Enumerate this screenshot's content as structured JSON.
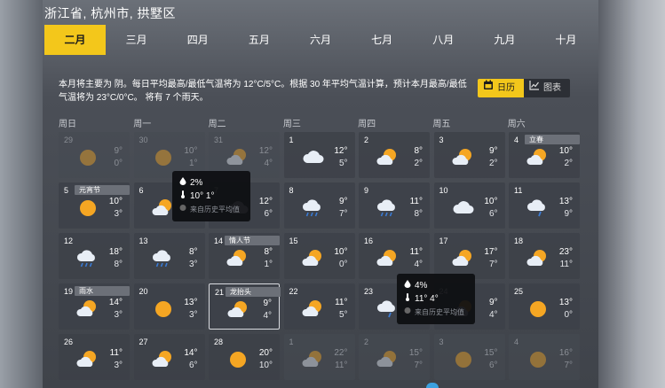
{
  "location": "浙江省, 杭州市, 拱墅区",
  "months": [
    {
      "label": "二月",
      "active": true
    },
    {
      "label": "三月",
      "active": false
    },
    {
      "label": "四月",
      "active": false
    },
    {
      "label": "五月",
      "active": false
    },
    {
      "label": "六月",
      "active": false
    },
    {
      "label": "七月",
      "active": false
    },
    {
      "label": "八月",
      "active": false
    },
    {
      "label": "九月",
      "active": false
    },
    {
      "label": "十月",
      "active": false
    }
  ],
  "summary": "本月将主要为 阴。每日平均最高/最低气温将为 12°C/5°C。根据 30 年平均气温计算，预计本月最高/最低气温将为 23°C/0°C。 将有 7 个雨天。",
  "view_toggle": {
    "calendar_label": "日历",
    "chart_label": "图表"
  },
  "weekdays": [
    "周日",
    "周一",
    "周二",
    "周三",
    "周四",
    "周五",
    "周六"
  ],
  "colors": {
    "accent": "#f3c71b"
  },
  "days": [
    {
      "date": "29",
      "hi": "9°",
      "lo": "0°",
      "icon": "sun-icon",
      "dim": true
    },
    {
      "date": "30",
      "hi": "10°",
      "lo": "1°",
      "icon": "sun-icon",
      "dim": true
    },
    {
      "date": "31",
      "hi": "12°",
      "lo": "4°",
      "icon": "partly-cloudy-icon",
      "dim": true
    },
    {
      "date": "1",
      "hi": "12°",
      "lo": "5°",
      "icon": "cloud-icon"
    },
    {
      "date": "2",
      "hi": "8°",
      "lo": "2°",
      "icon": "partly-cloudy-icon"
    },
    {
      "date": "3",
      "hi": "9°",
      "lo": "2°",
      "icon": "partly-cloudy-icon"
    },
    {
      "date": "4",
      "hi": "10°",
      "lo": "2°",
      "icon": "partly-cloudy-icon",
      "badge": "立春"
    },
    {
      "date": "5",
      "hi": "10°",
      "lo": "3°",
      "icon": "sun-icon",
      "badge": "元宵节"
    },
    {
      "date": "6",
      "hi": "",
      "lo": "",
      "icon": "partly-cloudy-icon"
    },
    {
      "date": "7",
      "hi": "12°",
      "lo": "6°",
      "icon": "cloud-icon"
    },
    {
      "date": "8",
      "hi": "9°",
      "lo": "7°",
      "icon": "rain-icon"
    },
    {
      "date": "9",
      "hi": "11°",
      "lo": "8°",
      "icon": "rain-icon"
    },
    {
      "date": "10",
      "hi": "10°",
      "lo": "6°",
      "icon": "cloud-icon"
    },
    {
      "date": "11",
      "hi": "13°",
      "lo": "9°",
      "icon": "cloud-rain-icon"
    },
    {
      "date": "12",
      "hi": "18°",
      "lo": "8°",
      "icon": "rain-icon"
    },
    {
      "date": "13",
      "hi": "8°",
      "lo": "3°",
      "icon": "rain-icon"
    },
    {
      "date": "14",
      "hi": "8°",
      "lo": "1°",
      "icon": "partly-cloudy-icon",
      "badge": "情人节"
    },
    {
      "date": "15",
      "hi": "10°",
      "lo": "0°",
      "icon": "partly-cloudy-icon"
    },
    {
      "date": "16",
      "hi": "11°",
      "lo": "4°",
      "icon": "partly-cloudy-icon"
    },
    {
      "date": "17",
      "hi": "17°",
      "lo": "7°",
      "icon": "partly-cloudy-icon"
    },
    {
      "date": "18",
      "hi": "23°",
      "lo": "11°",
      "icon": "partly-cloudy-icon"
    },
    {
      "date": "19",
      "hi": "14°",
      "lo": "3°",
      "icon": "partly-cloudy-icon",
      "badge": "雨水"
    },
    {
      "date": "20",
      "hi": "13°",
      "lo": "3°",
      "icon": "sun-icon"
    },
    {
      "date": "21",
      "hi": "9°",
      "lo": "4°",
      "icon": "partly-cloudy-icon",
      "badge": "龙抬头",
      "selected": true
    },
    {
      "date": "22",
      "hi": "11°",
      "lo": "5°",
      "icon": "partly-cloudy-icon"
    },
    {
      "date": "23",
      "hi": "",
      "lo": "",
      "icon": "cloud-rain-icon"
    },
    {
      "date": "24",
      "hi": "9°",
      "lo": "4°",
      "icon": "partly-cloudy-icon"
    },
    {
      "date": "25",
      "hi": "13°",
      "lo": "0°",
      "icon": "sun-icon"
    },
    {
      "date": "26",
      "hi": "11°",
      "lo": "3°",
      "icon": "partly-cloudy-icon"
    },
    {
      "date": "27",
      "hi": "14°",
      "lo": "6°",
      "icon": "partly-cloudy-icon"
    },
    {
      "date": "28",
      "hi": "20°",
      "lo": "10°",
      "icon": "sun-icon"
    },
    {
      "date": "1",
      "hi": "22°",
      "lo": "11°",
      "icon": "partly-cloudy-icon",
      "dim": true
    },
    {
      "date": "2",
      "hi": "15°",
      "lo": "7°",
      "icon": "partly-cloudy-icon",
      "dim": true
    },
    {
      "date": "3",
      "hi": "15°",
      "lo": "6°",
      "icon": "sun-icon",
      "dim": true
    },
    {
      "date": "4",
      "hi": "16°",
      "lo": "7°",
      "icon": "sun-icon",
      "dim": true
    }
  ],
  "tooltips": [
    {
      "precip": "2%",
      "temps": "10° 1°",
      "source": "来自历史平均值"
    },
    {
      "precip": "4%",
      "temps": "11° 4°",
      "source": "来自历史平均值"
    }
  ]
}
